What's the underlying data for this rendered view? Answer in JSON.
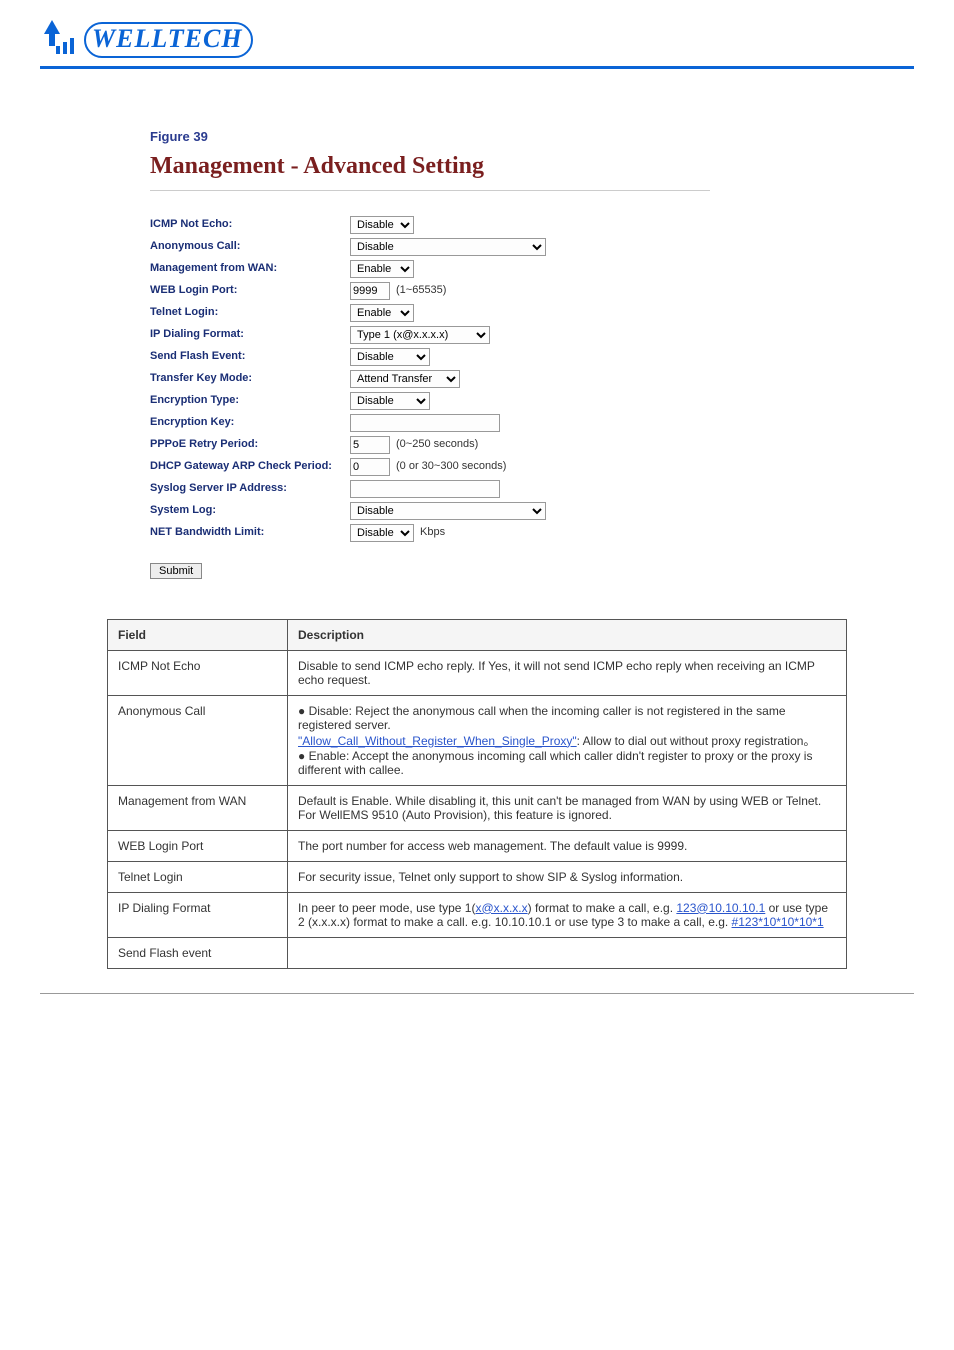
{
  "header": {
    "brand": "WELLTECH"
  },
  "figure": {
    "number": "Figure 39",
    "title": "Management - Advanced Setting"
  },
  "form": {
    "rows": [
      {
        "label": "ICMP Not Echo:",
        "type": "select",
        "value": "Disable",
        "cls": "w50"
      },
      {
        "label": "Anonymous Call:",
        "type": "select",
        "value": "Disable",
        "cls": "w190"
      },
      {
        "label": "Management from WAN:",
        "type": "select",
        "value": "Enable",
        "cls": "w50"
      },
      {
        "label": "WEB Login Port:",
        "type": "text",
        "value": "9999",
        "cls": "w40",
        "hint": "(1~65535)"
      },
      {
        "label": "Telnet Login:",
        "type": "select",
        "value": "Enable",
        "cls": "w50"
      },
      {
        "label": "IP Dialing Format:",
        "type": "select",
        "value": "Type 1 (x@x.x.x.x)",
        "cls": "w120"
      },
      {
        "label": "Send Flash Event:",
        "type": "select",
        "value": "Disable",
        "cls": "w70"
      },
      {
        "label": "Transfer Key Mode:",
        "type": "select",
        "value": "Attend Transfer",
        "cls": "w90"
      },
      {
        "label": "Encryption Type:",
        "type": "select",
        "value": "Disable",
        "cls": "w70"
      },
      {
        "label": "Encryption Key:",
        "type": "text",
        "value": "",
        "cls": "w150"
      },
      {
        "label": "PPPoE Retry Period:",
        "type": "text",
        "value": "5",
        "cls": "w40",
        "hint": "(0~250 seconds)"
      },
      {
        "label": "DHCP Gateway ARP Check Period:",
        "type": "text",
        "value": "0",
        "cls": "w40",
        "hint": "(0 or 30~300 seconds)"
      },
      {
        "label": "Syslog Server IP Address:",
        "type": "text",
        "value": "",
        "cls": "w150"
      },
      {
        "label": "System Log:",
        "type": "select",
        "value": "Disable",
        "cls": "w190"
      },
      {
        "label": "NET Bandwidth Limit:",
        "type": "select",
        "value": "Disable",
        "cls": "w50",
        "hint": "Kbps"
      }
    ],
    "submit": "Submit"
  },
  "table": {
    "head": [
      "Field",
      "Description"
    ],
    "rows": [
      [
        "ICMP Not Echo",
        "Disable to send ICMP echo reply. If Yes, it will not send ICMP echo reply when receiving an ICMP echo request."
      ],
      [
        "Anonymous Call",
        [
          "● Disable: Reject the anonymous call when the incoming caller is not registered in the same registered server.",
          "“Allow_Call_Without_Register_When_Single_Proxy”: Allow to dial out without proxy registration.",
          "● Enable: Accept the anonymous incoming call which caller didn't register to proxy or the proxy is different with callee."
        ]
      ],
      [
        "Management from WAN",
        "Default is Enable. While disabling it, this unit can't be managed from WAN by using WEB or Telnet. For WellEMS 9510 (Auto Provision), this feature is ignored."
      ],
      [
        "WEB Login Port",
        "The port number for access web management. The default value is 9999."
      ],
      [
        "Telnet Login",
        "For security issue, Telnet only support to show SIP & Syslog information."
      ],
      [
        "IP Dialing Format",
        [
          "In peer to peer mode, use type 1(x@x.x.x.x) format to make a call, e.g. 123@10.10.10.1 or use type 2 (x.x.x.x) format to make a call. e.g. 10.10.10.1 or use type 3 to make a call, e.g. #123*10*10*10*1"
        ]
      ],
      [
        "Send Flash event",
        ""
      ]
    ],
    "link1": "x@x.x.x.x",
    "link2": "123@10.10.10.1",
    "link3": "#123*10*10*10*1"
  }
}
